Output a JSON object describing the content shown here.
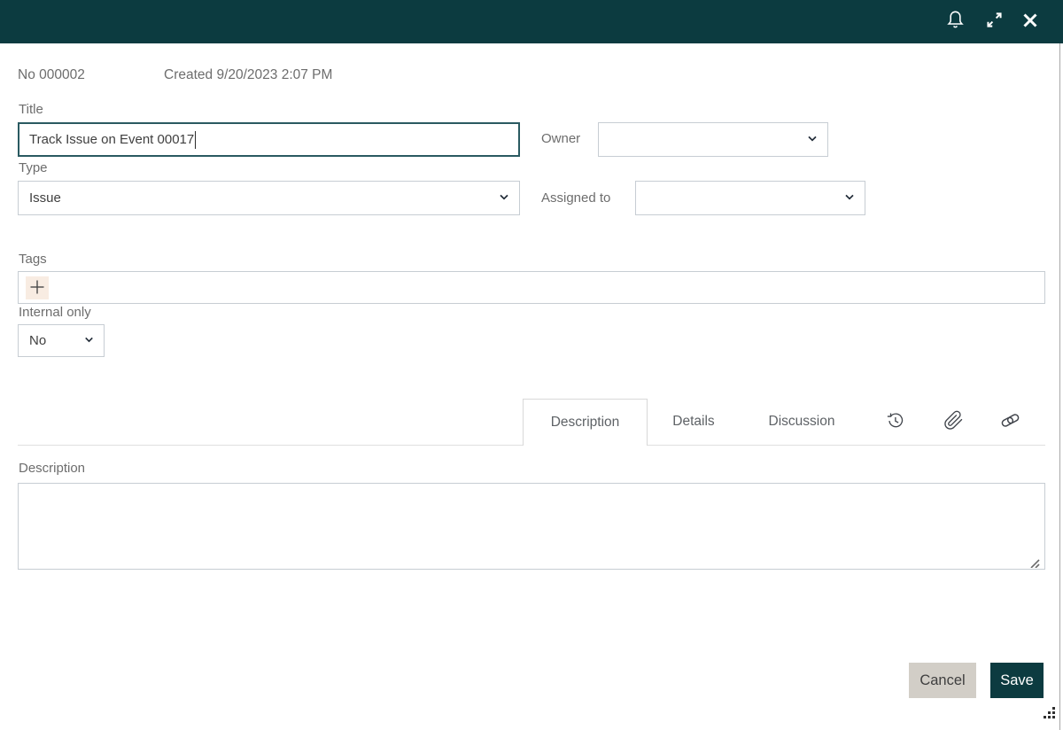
{
  "titlebar": {
    "background": "#0c3b40",
    "icons": [
      "bell-icon",
      "expand-icon",
      "close-icon"
    ]
  },
  "meta": {
    "number": "No 000002",
    "created": "Created 9/20/2023 2:07 PM"
  },
  "fields": {
    "title": {
      "label": "Title",
      "value": "Track Issue on Event 00017"
    },
    "owner": {
      "label": "Owner",
      "value": ""
    },
    "type": {
      "label": "Type",
      "value": "Issue"
    },
    "assigned_to": {
      "label": "Assigned to",
      "value": ""
    },
    "tags": {
      "label": "Tags",
      "add_icon": "plus-icon"
    },
    "internal_only": {
      "label": "Internal only",
      "value": "No"
    }
  },
  "tabs": {
    "active": "Description",
    "items": [
      {
        "label": "Description"
      },
      {
        "label": "Details"
      },
      {
        "label": "Discussion"
      }
    ],
    "icon_buttons": [
      "history-icon",
      "paperclip-icon",
      "link-icon"
    ]
  },
  "description_section": {
    "label": "Description",
    "value": ""
  },
  "footer": {
    "cancel": "Cancel",
    "save": "Save"
  },
  "colors": {
    "header_bg": "#0c3b40",
    "save_bg": "#0c3b40",
    "cancel_bg": "#d2cec7",
    "focus_border": "#2a5a61",
    "control_border": "#c7cdd3",
    "tag_add_bg": "#f8ece2",
    "label_text": "#6d6d6d",
    "value_text": "#3f3f3f"
  }
}
